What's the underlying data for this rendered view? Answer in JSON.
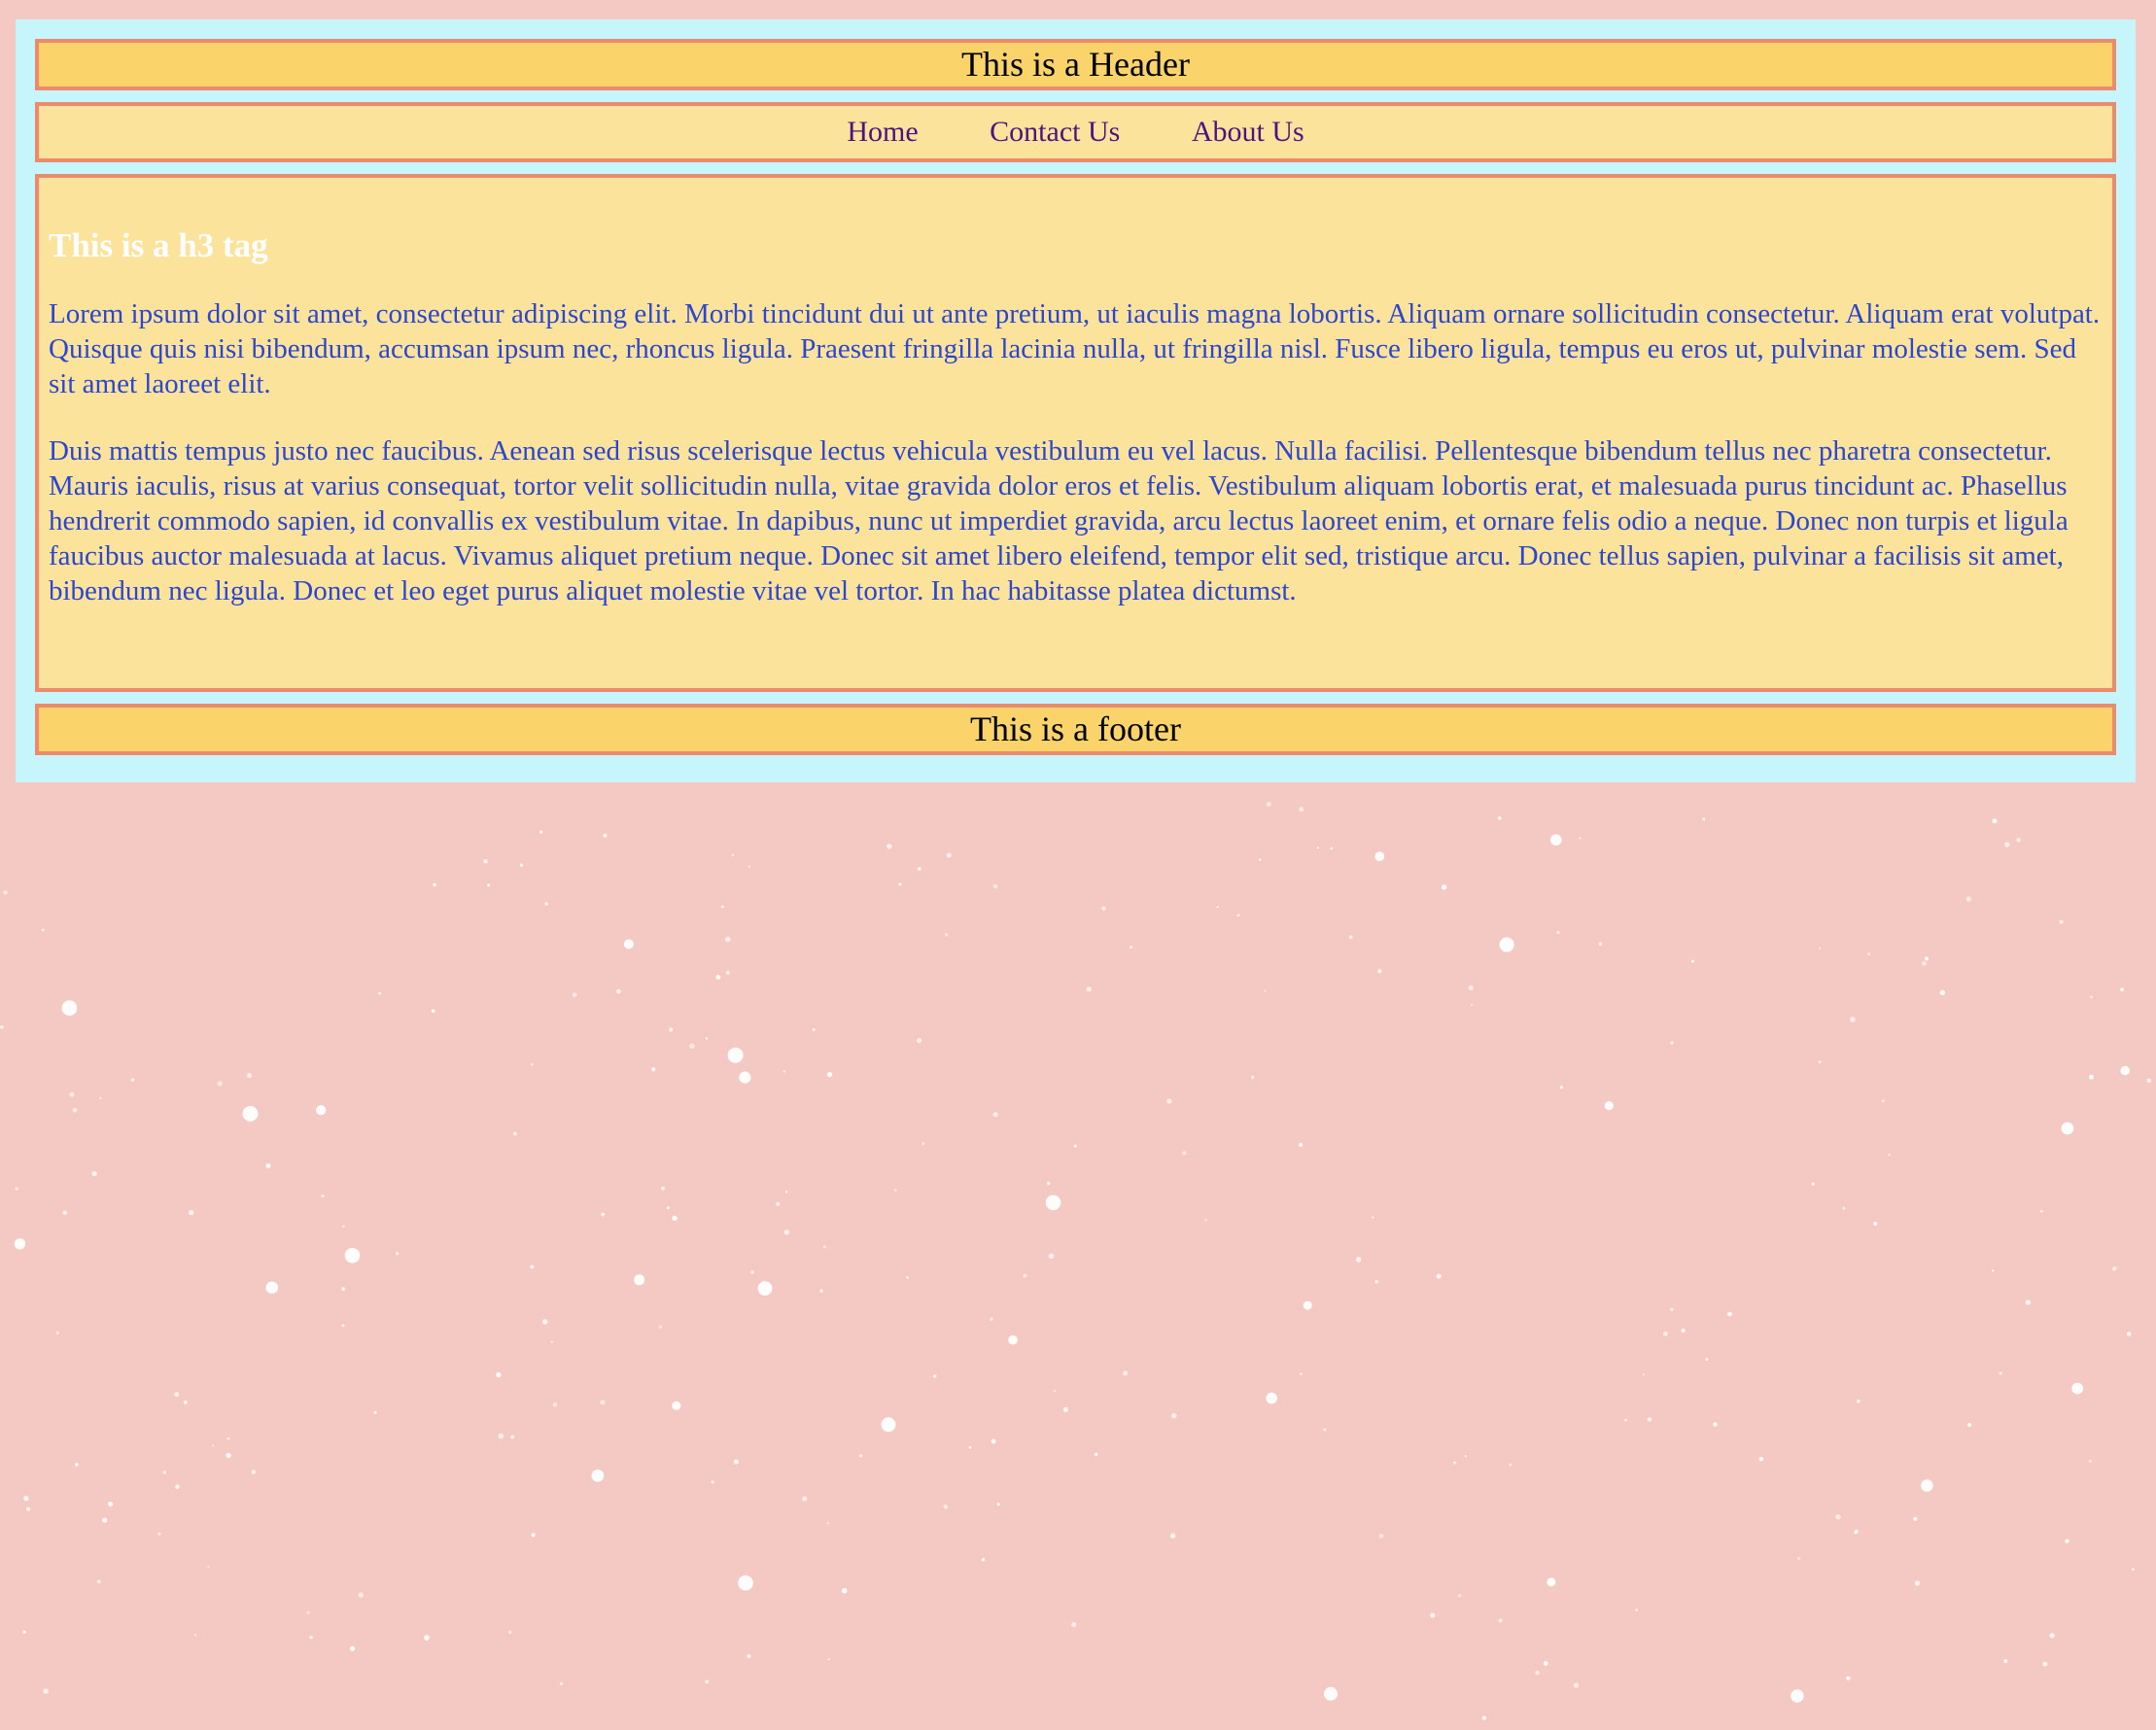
{
  "colors": {
    "page_background": "#f4c9c3",
    "container_background": "#c6f6fb",
    "header_background": "#fad46b",
    "content_background": "#fce39c",
    "border": "#ec8a6e",
    "link": "#4b1580",
    "paragraph_text": "#2b46cf",
    "heading_text": "#ffffff"
  },
  "header": {
    "title": "This is a Header"
  },
  "nav": {
    "items": [
      {
        "label": "Home"
      },
      {
        "label": "Contact Us"
      },
      {
        "label": "About Us"
      }
    ]
  },
  "main": {
    "heading": "This is a h3 tag",
    "paragraphs": [
      "Lorem ipsum dolor sit amet, consectetur adipiscing elit. Morbi tincidunt dui ut ante pretium, ut iaculis magna lobortis. Aliquam ornare sollicitudin consectetur. Aliquam erat volutpat. Quisque quis nisi bibendum, accumsan ipsum nec, rhoncus ligula. Praesent fringilla lacinia nulla, ut fringilla nisl. Fusce libero ligula, tempus eu eros ut, pulvinar molestie sem. Sed sit amet laoreet elit.",
      "Duis mattis tempus justo nec faucibus. Aenean sed risus scelerisque lectus vehicula vestibulum eu vel lacus. Nulla facilisi. Pellentesque bibendum tellus nec pharetra consectetur. Mauris iaculis, risus at varius consequat, tortor velit sollicitudin nulla, vitae gravida dolor eros et felis. Vestibulum aliquam lobortis erat, et malesuada purus tincidunt ac. Phasellus hendrerit commodo sapien, id convallis ex vestibulum vitae. In dapibus, nunc ut imperdiet gravida, arcu lectus laoreet enim, et ornare felis odio a neque. Donec non turpis et ligula faucibus auctor malesuada at lacus. Vivamus aliquet pretium neque. Donec sit amet libero eleifend, tempor elit sed, tristique arcu. Donec tellus sapien, pulvinar a facilisis sit amet, bibendum nec ligula. Donec et leo eget purus aliquet molestie vitae vel tortor. In hac habitasse platea dictumst."
    ]
  },
  "footer": {
    "text": "This is a footer"
  }
}
